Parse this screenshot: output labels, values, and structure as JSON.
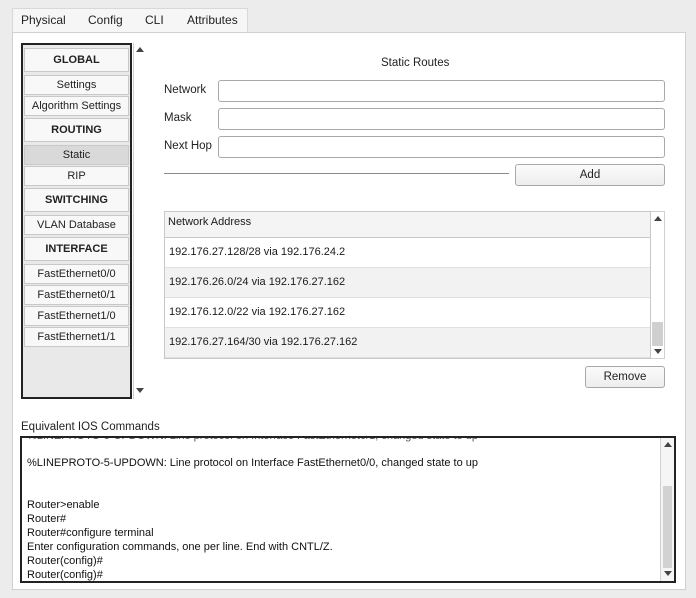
{
  "tabs": [
    "Physical",
    "Config",
    "CLI",
    "Attributes"
  ],
  "active_tab": "Config",
  "nav": {
    "items": [
      {
        "label": "GLOBAL",
        "type": "header"
      },
      {
        "label": "Settings",
        "type": "item"
      },
      {
        "label": "Algorithm Settings",
        "type": "item"
      },
      {
        "label": "ROUTING",
        "type": "header"
      },
      {
        "label": "Static",
        "type": "item",
        "selected": true
      },
      {
        "label": "RIP",
        "type": "item"
      },
      {
        "label": "SWITCHING",
        "type": "header"
      },
      {
        "label": "VLAN Database",
        "type": "item"
      },
      {
        "label": "INTERFACE",
        "type": "header"
      },
      {
        "label": "FastEthernet0/0",
        "type": "item"
      },
      {
        "label": "FastEthernet0/1",
        "type": "item"
      },
      {
        "label": "FastEthernet1/0",
        "type": "item"
      },
      {
        "label": "FastEthernet1/1",
        "type": "item"
      }
    ]
  },
  "static_routes": {
    "title": "Static Routes",
    "network_label": "Network",
    "network_value": "",
    "mask_label": "Mask",
    "mask_value": "",
    "next_hop_label": "Next Hop",
    "next_hop_value": "",
    "add_label": "Add",
    "remove_label": "Remove",
    "table_header": "Network Address",
    "routes": [
      "192.176.27.128/28 via 192.176.24.2",
      "192.176.26.0/24 via 192.176.27.162",
      "192.176.12.0/22 via 192.176.27.162",
      "192.176.27.164/30 via 192.176.27.162"
    ]
  },
  "ios": {
    "label": "Equivalent IOS Commands",
    "lines": [
      "%LINEPROTO-5-UPDOWN: Line protocol on Interface FastEthernet0/0, changed state to up",
      "",
      "",
      "Router>enable",
      "Router#",
      "Router#configure terminal",
      "Enter configuration commands, one per line.  End with CNTL/Z.",
      "Router(config)#",
      "Router(config)#"
    ]
  }
}
